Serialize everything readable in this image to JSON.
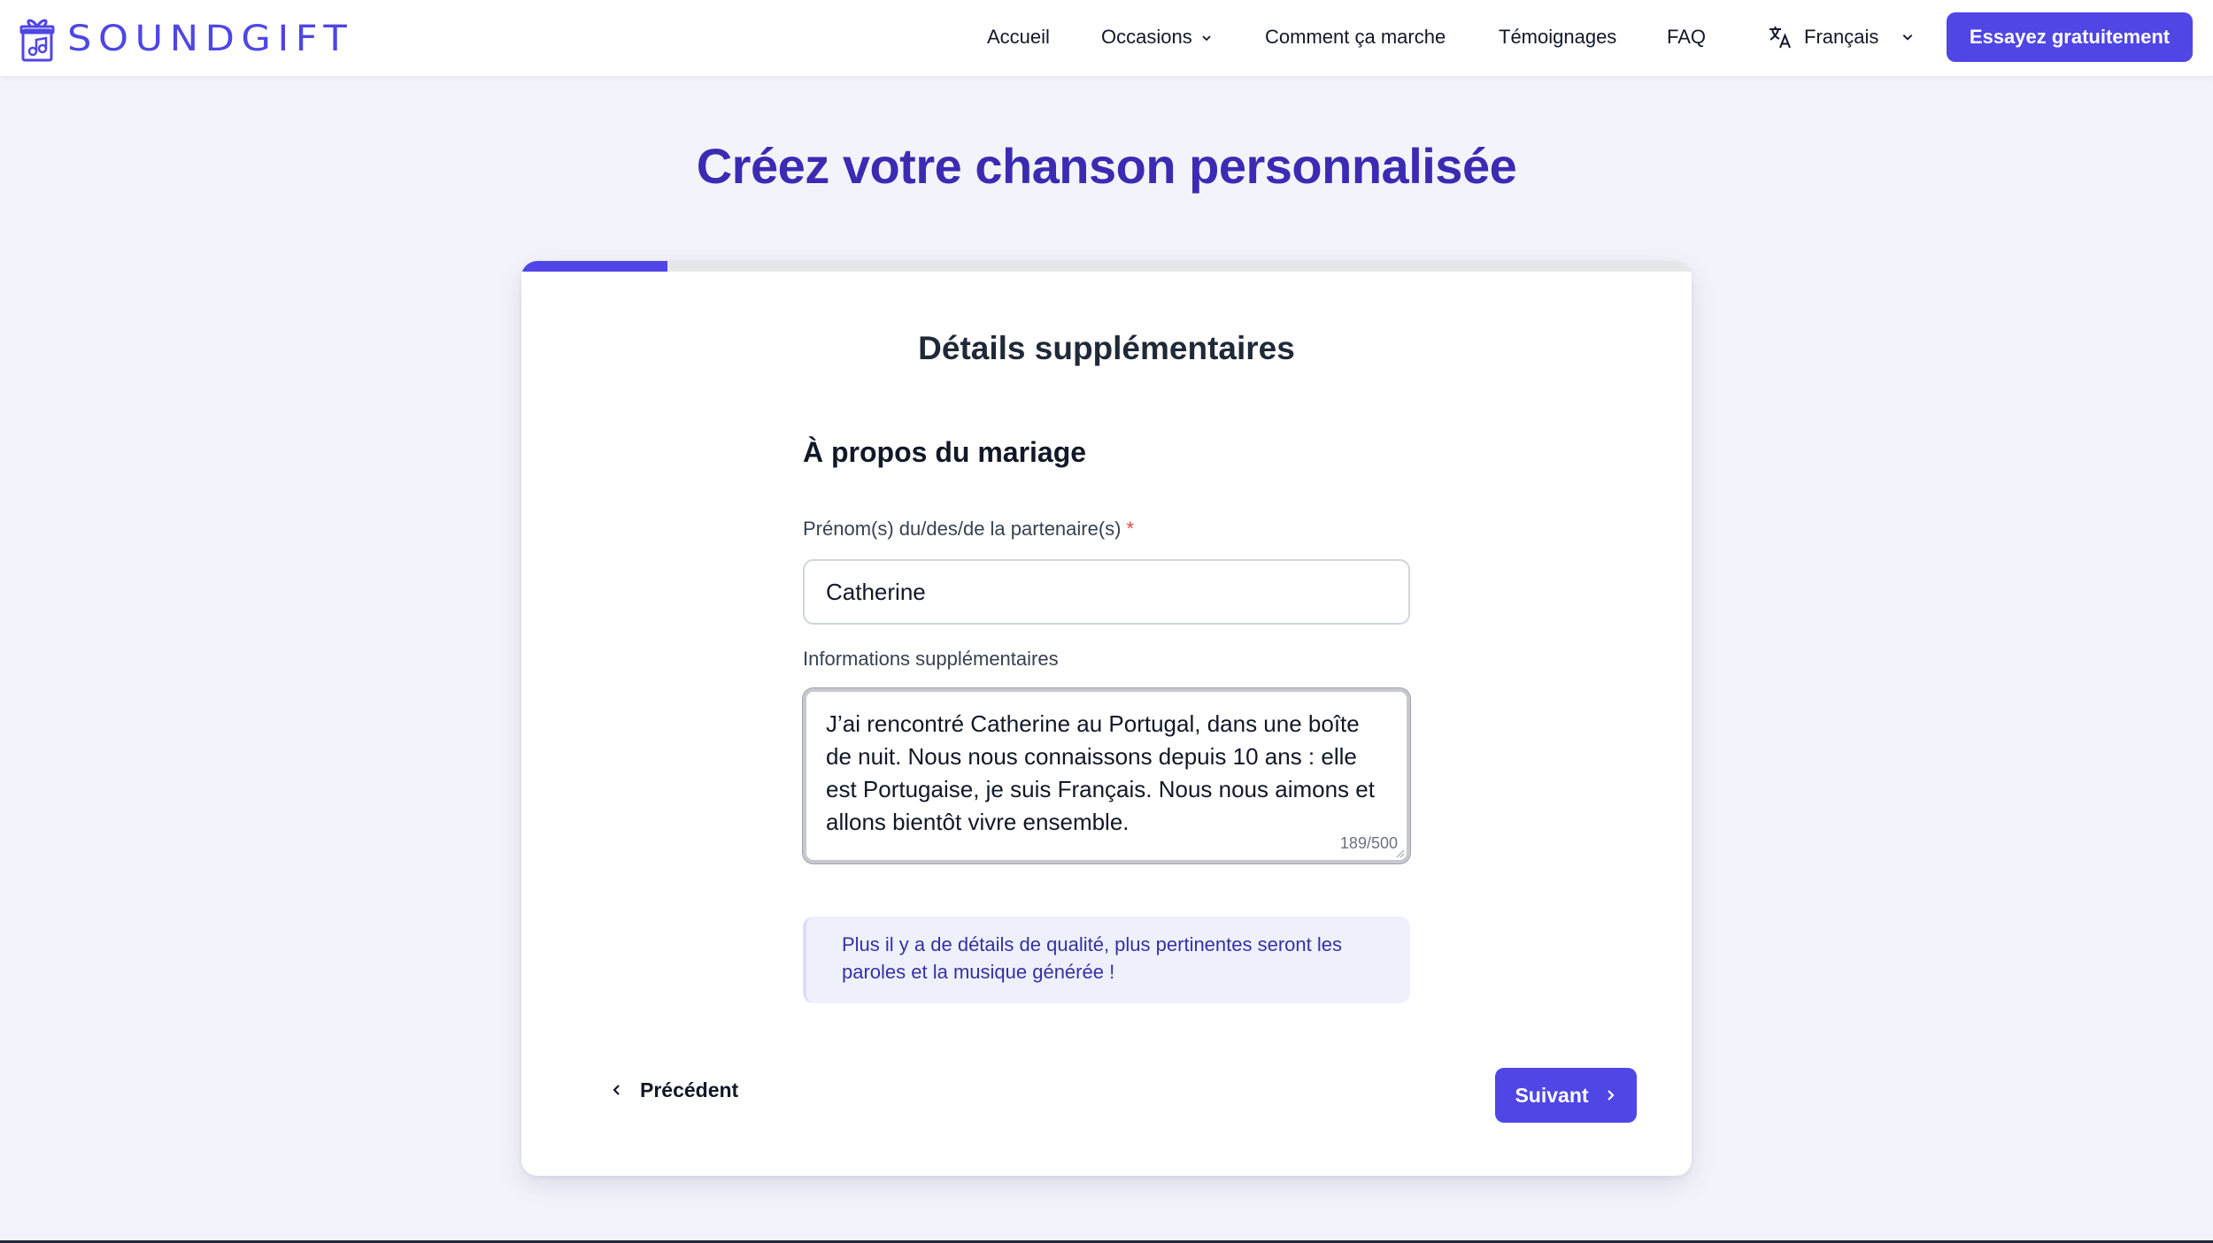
{
  "brand": {
    "name": "SOUNDGIFT",
    "color": "#4f46e5"
  },
  "nav": {
    "home": "Accueil",
    "occasions": "Occasions",
    "how_it_works": "Comment ça marche",
    "testimonials": "Témoignages",
    "faq": "FAQ",
    "language": "Français",
    "cta": "Essayez gratuitement"
  },
  "page": {
    "title": "Créez votre chanson personnalisée"
  },
  "form": {
    "progress_fraction": 0.125,
    "step_title": "Détails supplémentaires",
    "section_title": "À propos du mariage",
    "partner_label": "Prénom(s) du/des/de la partenaire(s)",
    "required_mark": "*",
    "partner_value": "Catherine",
    "info_label": "Informations supplémentaires",
    "info_value": "J’ai rencontré Catherine au Portugal, dans une boîte de nuit. Nous nous connaissons depuis 10 ans : elle est Portugaise, je suis Français. Nous nous aimons et allons bientôt vivre ensemble.",
    "char_counter": "189/500",
    "tip": "Plus il y a de détails de qualité, plus pertinentes seront les paroles et la musique générée !",
    "prev_label": "Précédent",
    "next_label": "Suivant"
  },
  "icons": {
    "logo": "gift-music-icon",
    "translate": "translate-icon",
    "chevron_down": "chevron-down-icon",
    "chevron_left": "chevron-left-icon",
    "chevron_right": "chevron-right-icon"
  },
  "colors": {
    "accent": "#4f46e5",
    "title": "#3b2bb3",
    "tip_bg": "#eef0fc",
    "tip_text": "#3730a3",
    "required": "#ef4444"
  }
}
